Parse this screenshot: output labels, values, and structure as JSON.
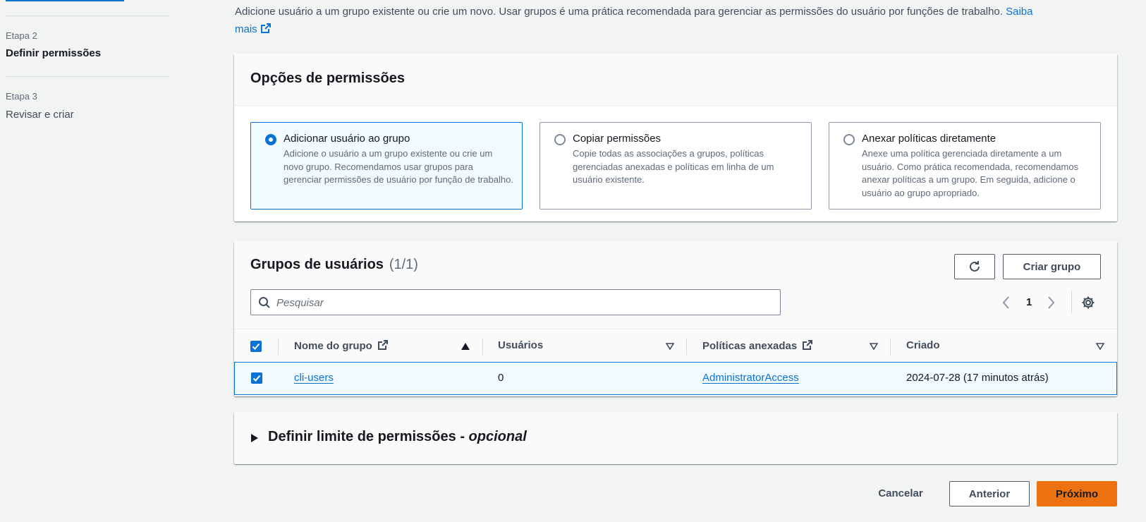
{
  "sidebar": {
    "steps": [
      {
        "label": "Etapa 2",
        "name": "Definir permissões",
        "active": true
      },
      {
        "label": "Etapa 3",
        "name": "Revisar e criar",
        "active": false
      }
    ]
  },
  "intro": {
    "text": "Adicione usuário a um grupo existente ou crie um novo. Usar grupos é uma prática recomendada para gerenciar as permissões do usuário por funções de trabalho.",
    "link_part1": "Saiba",
    "link_part2": "mais"
  },
  "permission_options": {
    "title": "Opções de permissões",
    "options": [
      {
        "title": "Adicionar usuário ao grupo",
        "description": "Adicione o usuário a um grupo existente ou crie um novo grupo. Recomendamos usar grupos para gerenciar permissões de usuário por função de trabalho.",
        "selected": true
      },
      {
        "title": "Copiar permissões",
        "description": "Copie todas as associações a grupos, políticas gerenciadas anexadas e políticas em linha de um usuário existente.",
        "selected": false
      },
      {
        "title": "Anexar políticas diretamente",
        "description": "Anexe uma política gerenciada diretamente a um usuário. Como prática recomendada, recomendamos anexar políticas a um grupo. Em seguida, adicione o usuário ao grupo apropriado.",
        "selected": false
      }
    ]
  },
  "user_groups": {
    "title": "Grupos de usuários",
    "count": "(1/1)",
    "create_button": "Criar grupo",
    "search_placeholder": "Pesquisar",
    "page_number": "1",
    "columns": [
      "Nome do grupo",
      "Usuários",
      "Políticas anexadas",
      "Criado"
    ],
    "rows": [
      {
        "name": "cli-users",
        "users": "0",
        "policies": "AdministratorAccess",
        "created": "2024-07-28 (17 minutos atrás)",
        "checked": true
      }
    ]
  },
  "boundary": {
    "title": "Definir limite de permissões - ",
    "optional": "opcional"
  },
  "footer": {
    "cancel": "Cancelar",
    "previous": "Anterior",
    "next": "Próximo"
  },
  "colors": {
    "accent": "#0972d3",
    "primary_button": "#ec7211"
  }
}
